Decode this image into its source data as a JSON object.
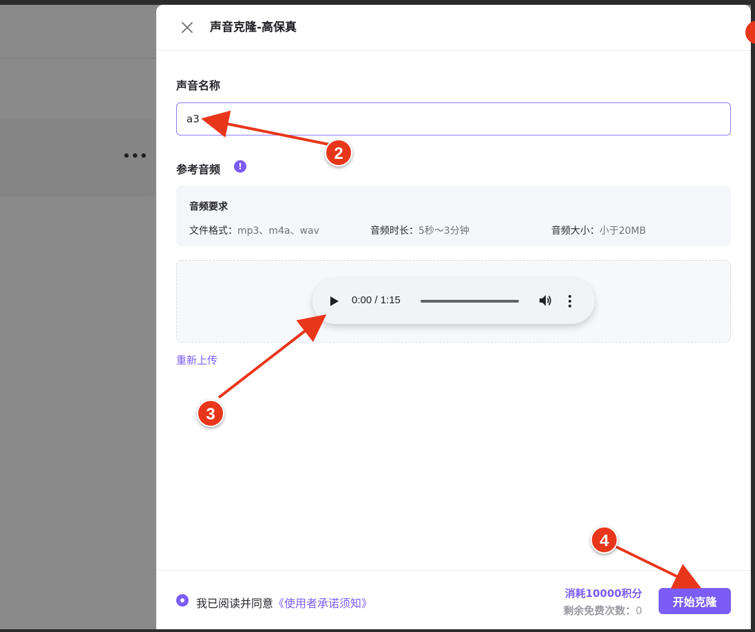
{
  "background": {
    "more_icon": "more-horizontal-icon",
    "more_glyph": "•••"
  },
  "drawer": {
    "close_icon": "close-icon",
    "title": "声音克隆-高保真"
  },
  "voice_name": {
    "label": "声音名称",
    "value": "a3"
  },
  "reference_audio": {
    "label": "参考音频",
    "info_glyph": "!",
    "requirements": {
      "title": "音频要求",
      "format_key": "文件格式：",
      "format_value": "mp3、m4a、wav",
      "duration_key": "音频时长：",
      "duration_value": "5秒～3分钟",
      "size_key": "音频大小：",
      "size_value": "小于20MB"
    },
    "player": {
      "time": "0:00 / 1:15",
      "progress": 0
    },
    "reupload": "重新上传"
  },
  "footer": {
    "agree_prefix": "我已阅读并同意",
    "agree_link": "《使用者承诺须知》",
    "cost": "消耗10000积分",
    "free_label": "剩余免费次数：",
    "free_count": "0",
    "clone_button": "开始克隆"
  },
  "annotations": {
    "step2": "2",
    "step3": "3",
    "step4": "4",
    "color": "#e8361b"
  },
  "colors": {
    "accent": "#7b5cf5",
    "overlay": "#8a8a8a"
  }
}
